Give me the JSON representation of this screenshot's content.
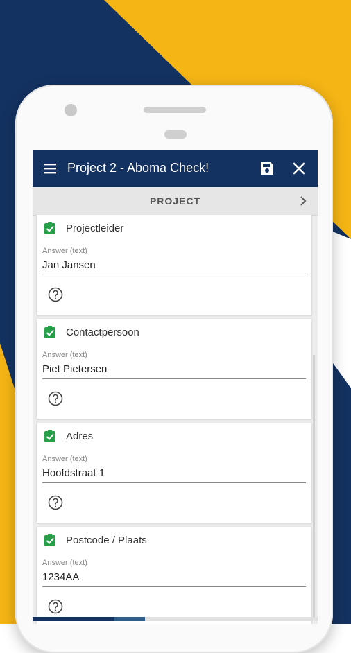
{
  "colors": {
    "navy": "#143261",
    "gold": "#f5b515",
    "check_green": "#27a04a"
  },
  "app": {
    "title": "Project 2 - Aboma Check!"
  },
  "toolbar": {
    "menu_icon": "menu-icon",
    "save_icon": "save-icon",
    "close_icon": "close-icon"
  },
  "section": {
    "label": "PROJECT",
    "chevron_icon": "chevron-right-icon"
  },
  "questions": [
    {
      "title": "Projectleider",
      "answer_label": "Answer (text)",
      "answer": "Jan Jansen"
    },
    {
      "title": "Contactpersoon",
      "answer_label": "Answer (text)",
      "answer": "Piet Pietersen"
    },
    {
      "title": "Adres",
      "answer_label": "Answer (text)",
      "answer": "Hoofdstraat 1"
    },
    {
      "title": "Postcode / Plaats",
      "answer_label": "Answer (text)",
      "answer": "1234AA"
    }
  ],
  "progress": {
    "completed_fraction": 0.285,
    "current_fraction": 0.11
  }
}
